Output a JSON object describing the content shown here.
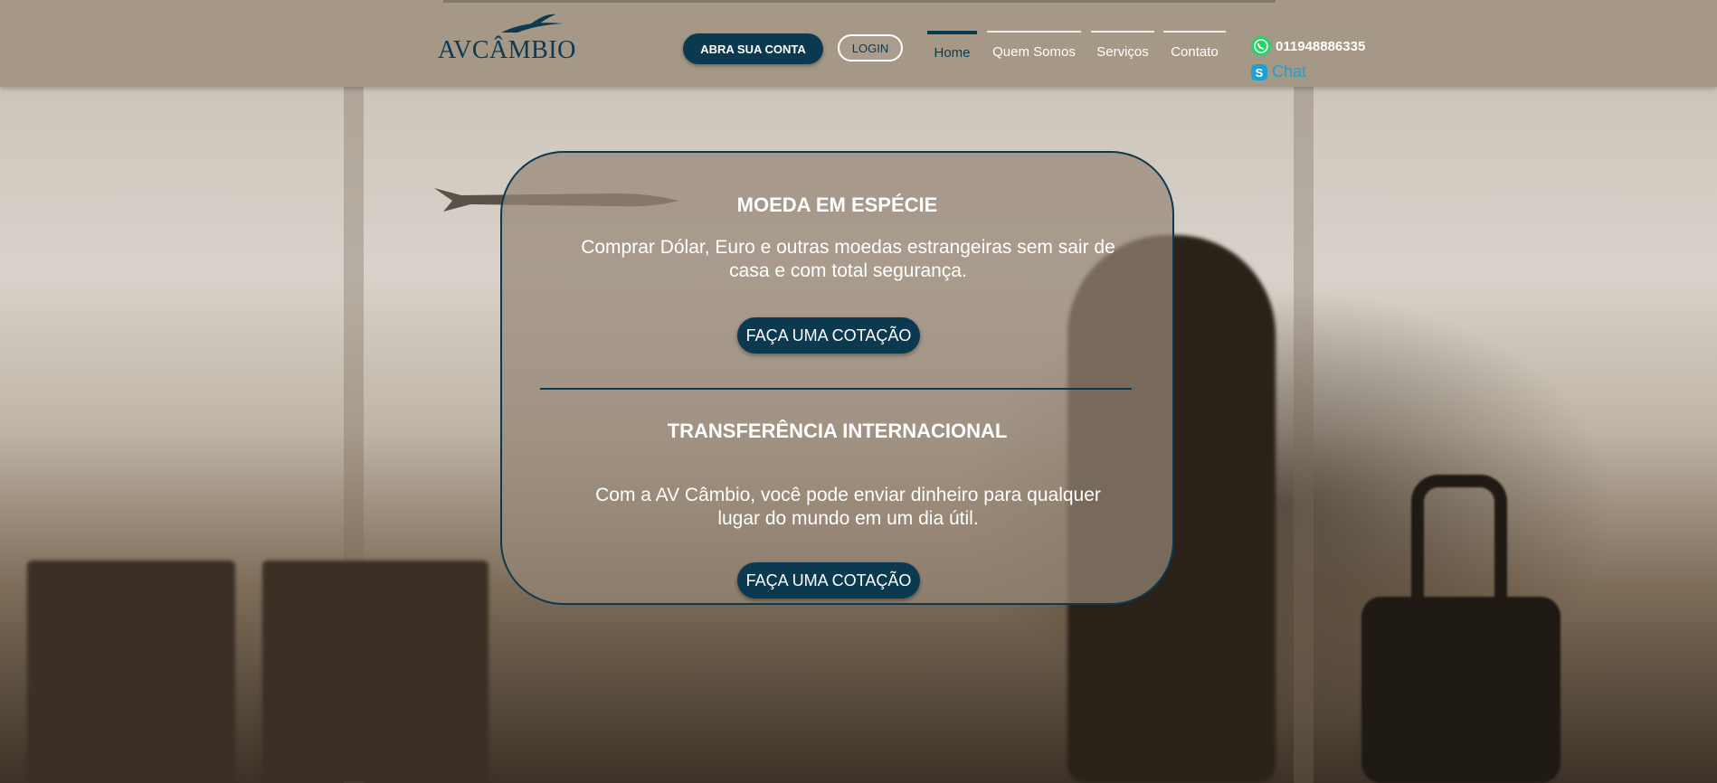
{
  "colors": {
    "brand_navy": "#0b3a50",
    "skype_blue": "#1ba0d8",
    "whatsapp_green": "#25d366"
  },
  "header": {
    "logo_text": "AVCÂMBIO",
    "open_account_label": "ABRA SUA CONTA",
    "login_label": "LOGIN",
    "nav": [
      {
        "label": "Home",
        "active": true
      },
      {
        "label": "Quem Somos",
        "active": false
      },
      {
        "label": "Serviços",
        "active": false
      },
      {
        "label": "Contato",
        "active": false
      }
    ],
    "whatsapp_icon": "whatsapp-icon",
    "phone": "011948886335",
    "skype_icon": "skype-icon",
    "chat_label": "Chat"
  },
  "card": {
    "section1": {
      "title": "MOEDA EM ESPÉCIE",
      "text": "Comprar Dólar, Euro e outras moedas estrangeiras sem sair de casa e com total segurança.",
      "button": "FAÇA UMA COTAÇÃO"
    },
    "section2": {
      "title": "TRANSFERÊNCIA INTERNACIONAL",
      "text": "Com a AV Câmbio, você pode enviar dinheiro para qualquer lugar do mundo em um dia útil.",
      "button": "FAÇA UMA COTAÇÃO"
    }
  }
}
